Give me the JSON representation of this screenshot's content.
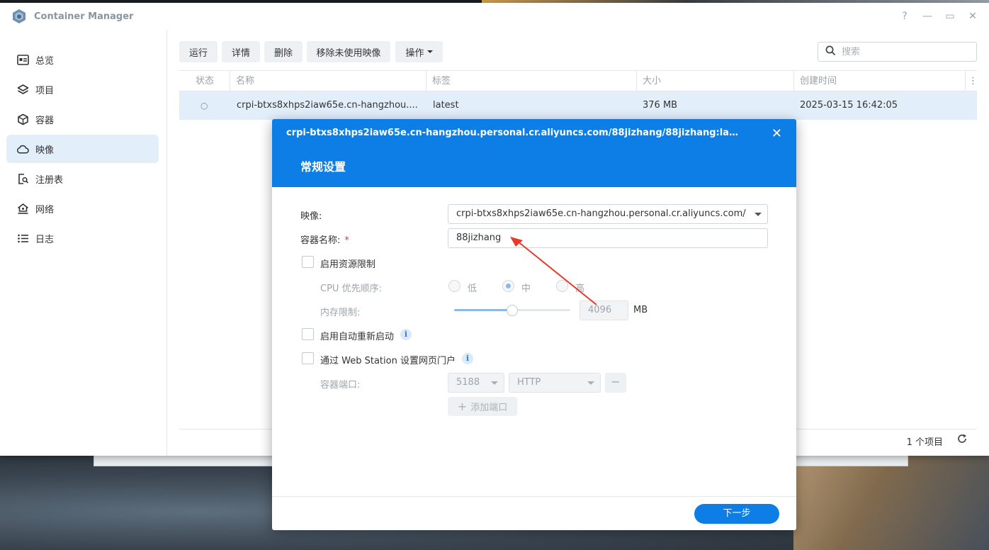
{
  "window": {
    "title": "Container Manager",
    "controls": [
      "help-icon",
      "minimize-icon",
      "maximize-icon",
      "close-icon"
    ]
  },
  "sidebar": {
    "items": [
      {
        "label": "总览",
        "icon": "overview-icon"
      },
      {
        "label": "项目",
        "icon": "layers-icon"
      },
      {
        "label": "容器",
        "icon": "cube-icon"
      },
      {
        "label": "映像",
        "icon": "cloud-icon",
        "active": true
      },
      {
        "label": "注册表",
        "icon": "registry-search-icon"
      },
      {
        "label": "网络",
        "icon": "network-home-icon"
      },
      {
        "label": "日志",
        "icon": "list-icon"
      }
    ]
  },
  "toolbar": {
    "run": "运行",
    "details": "详情",
    "delete": "删除",
    "remove_unused": "移除未使用映像",
    "actions": "操作",
    "search_placeholder": "搜索"
  },
  "table": {
    "columns": [
      "状态",
      "名称",
      "标签",
      "大小",
      "创建时间"
    ],
    "rows": [
      {
        "status": "○",
        "name": "crpi-btxs8xhps2iaw65e.cn-hangzhou....",
        "tag": "latest",
        "size": "376 MB",
        "created": "2025-03-15 16:42:05"
      }
    ],
    "footer_count": "1 个项目"
  },
  "modal": {
    "title": "crpi-btxs8xhps2iaw65e.cn-hangzhou.personal.cr.aliyuncs.com/88jizhang/88jizhang:late...",
    "section": "常规设置",
    "image_label": "映像:",
    "image_value": "crpi-btxs8xhps2iaw65e.cn-hangzhou.personal.cr.aliyuncs.com/",
    "name_label": "容器名称:",
    "name_required": "*",
    "name_value": "88jizhang",
    "resource_limit": "启用资源限制",
    "cpu_label": "CPU 优先顺序:",
    "cpu_low": "低",
    "cpu_mid": "中",
    "cpu_high": "高",
    "cpu_selected": "中",
    "mem_label": "内存限制:",
    "mem_value": "4096",
    "mem_unit": "MB",
    "mem_slider_fraction": 0.5,
    "auto_restart": "启用自动重新启动",
    "web_station": "通过 Web Station 设置网页门户",
    "port_label": "容器端口:",
    "port_value": "5188",
    "protocol_value": "HTTP",
    "remove_port": "−",
    "add_port": "添加端口",
    "next": "下一步"
  },
  "colors": {
    "accent": "#0c7ee6",
    "selected_row": "#e3eefb",
    "arrow": "#e8392b"
  }
}
